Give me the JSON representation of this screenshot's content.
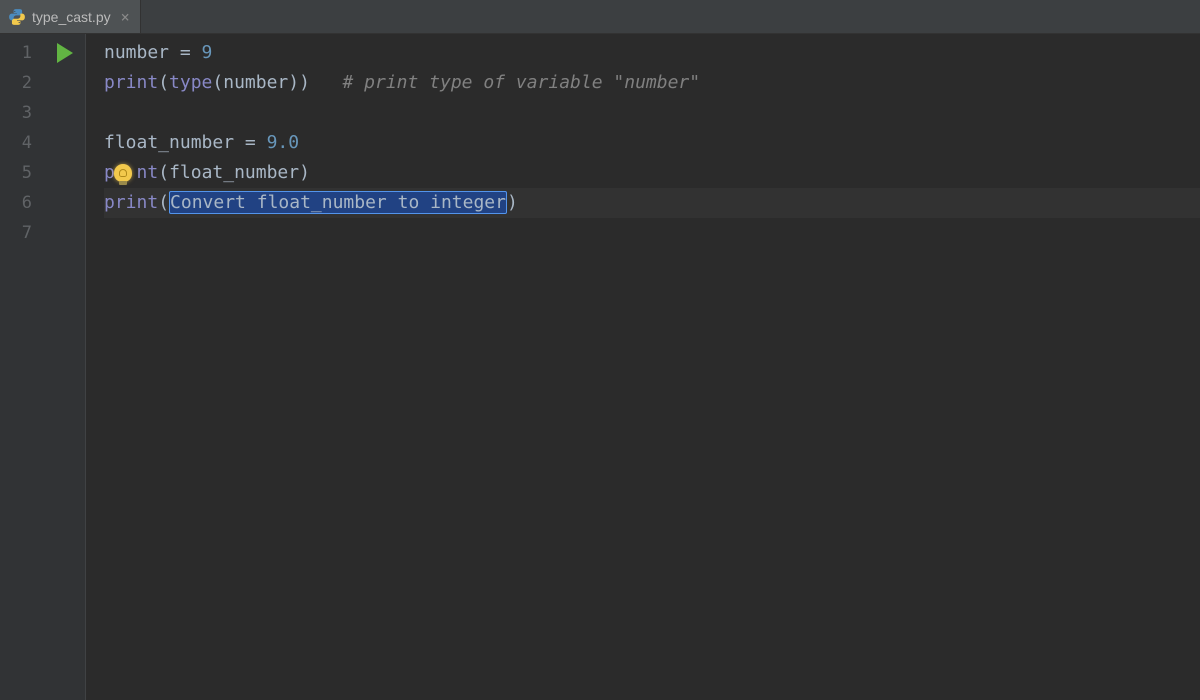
{
  "tab": {
    "label": "type_cast.py"
  },
  "gutter": {
    "lines": [
      "1",
      "2",
      "3",
      "4",
      "5",
      "6",
      "7"
    ]
  },
  "code": {
    "l1": {
      "var": "number",
      "eq": " = ",
      "val": "9"
    },
    "l2": {
      "print": "print",
      "lp": "(",
      "type": "type",
      "lp2": "(",
      "arg": "number",
      "rp2": ")",
      "rp": ")",
      "pad": "   ",
      "comment": "# print type of variable \"number\""
    },
    "l4": {
      "var": "float_number",
      "eq": " = ",
      "val": "9.0"
    },
    "l5": {
      "p1": "p",
      "p_hidden": "ri",
      "p2": "nt",
      "lp": "(",
      "arg": "float_number",
      "rp": ")"
    },
    "l6": {
      "print": "print",
      "lp": "(",
      "placeholder": "Convert float_number to integer",
      "rp": ")"
    }
  }
}
